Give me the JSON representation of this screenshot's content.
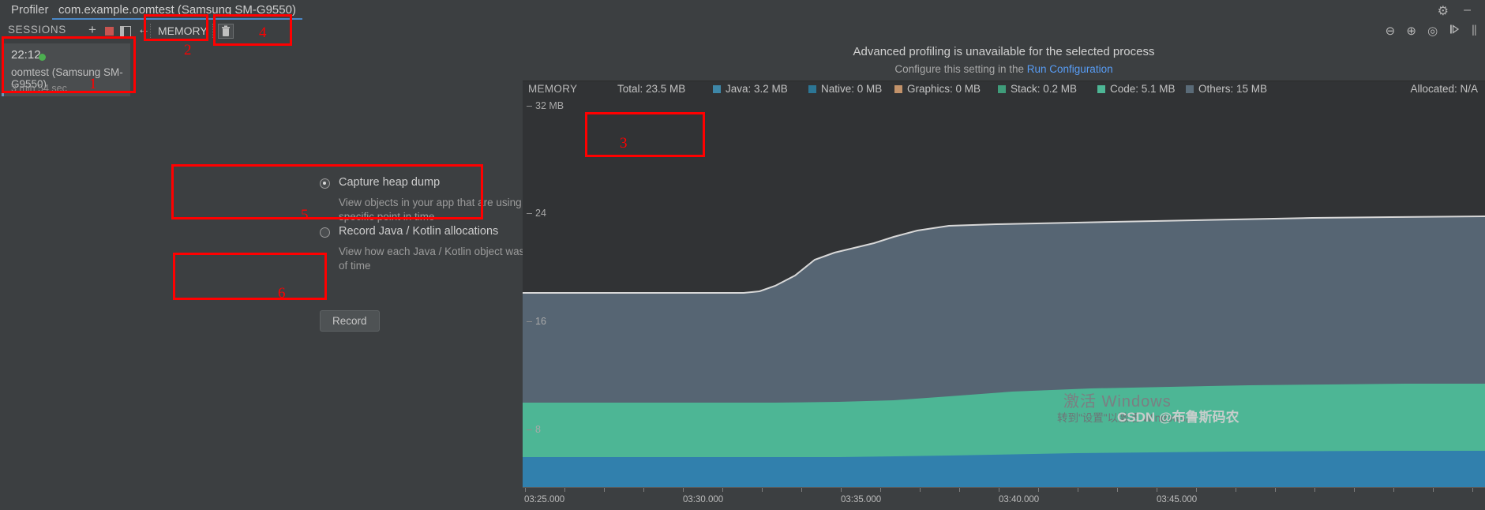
{
  "window": {
    "tab_profiler": "Profiler",
    "tab_process": "com.example.oomtest (Samsung SM-G9550)",
    "gear_icon": "gear-icon",
    "minimize_icon": "minimize-icon"
  },
  "toolbar": {
    "sessions_label": "SESSIONS",
    "add_icon": "+",
    "stop_icon": "stop-square-icon",
    "panel_icon": "split-panel-icon",
    "collapse_icon": "←",
    "memory_dropdown": "MEMORY",
    "caret": "▼",
    "trash_icon": "trash-icon",
    "zoom_out_icon": "⊖",
    "zoom_in_icon": "⊕",
    "reset_zoom_icon": "◎",
    "jump_to_live_icon": "jump-live-icon",
    "pause_icon": "‖"
  },
  "sessions": {
    "items": [
      {
        "time": "22:12",
        "status_dot": "green",
        "name": "oomtest (Samsung SM-G9550)",
        "duration": "3 min 54 sec"
      }
    ]
  },
  "capture_panel": {
    "options": [
      {
        "label": "Capture heap dump",
        "description": "View objects in your app that are using memory at a specific point in time",
        "selected": true
      },
      {
        "label": "Record Java / Kotlin allocations",
        "description": "View how each Java / Kotlin object was allocated over a period of time",
        "selected": false
      }
    ],
    "record_button": "Record"
  },
  "graph": {
    "banner_title": "Advanced profiling is unavailable for the selected process",
    "banner_sub_prefix": "Configure this setting in the ",
    "banner_link": "Run Configuration",
    "legend_title": "MEMORY",
    "total": "Total: 23.5 MB",
    "allocated": "Allocated: N/A",
    "series": [
      {
        "name": "Java",
        "value": "Java: 3.2 MB",
        "color": "#3e87a8"
      },
      {
        "name": "Native",
        "value": "Native: 0 MB",
        "color": "#2c7695"
      },
      {
        "name": "Graphics",
        "value": "Graphics: 0 MB",
        "color": "#c2926a"
      },
      {
        "name": "Stack",
        "value": "Stack: 0.2 MB",
        "color": "#3f9c7a"
      },
      {
        "name": "Code",
        "value": "Code: 5.1 MB",
        "color": "#4db695"
      },
      {
        "name": "Others",
        "value": "Others: 15 MB",
        "color": "#5a6b78"
      }
    ]
  },
  "chart_data": {
    "type": "area",
    "title": "MEMORY",
    "ylabel": "MB",
    "xlabel": "",
    "ylim": [
      0,
      34
    ],
    "yticks": [
      "32 MB",
      "24",
      "16",
      "8"
    ],
    "ytick_values": [
      32,
      24,
      16,
      8
    ],
    "xticks": [
      "03:25.000",
      "03:30.000",
      "03:35.000",
      "03:40.000",
      "03:45.000"
    ],
    "grid": false,
    "legend_position": "top",
    "series": [
      {
        "name": "Others",
        "color": "#5a6b78",
        "values": [
          17.0,
          17.0,
          17.0,
          17.0,
          17.0,
          17.0,
          17.0,
          17.0,
          17.0,
          17.0,
          17.3,
          19.0,
          20.5,
          21.2,
          21.5,
          22.0,
          23.0,
          23.4,
          23.5,
          23.5,
          23.5,
          23.6,
          23.6,
          23.7,
          23.8
        ]
      },
      {
        "name": "Code",
        "color": "#4db695",
        "values": [
          7.4,
          7.4,
          7.4,
          7.4,
          7.4,
          7.4,
          7.4,
          7.4,
          7.4,
          7.4,
          7.4,
          7.4,
          7.4,
          7.4,
          7.4,
          7.5,
          7.8,
          8.1,
          8.3,
          8.4,
          8.4,
          8.4,
          8.4,
          8.4,
          8.4
        ]
      },
      {
        "name": "Java",
        "color": "#3e87a8",
        "values": [
          2.3,
          2.3,
          2.3,
          2.3,
          2.3,
          2.3,
          2.3,
          2.3,
          2.3,
          2.3,
          2.3,
          2.3,
          2.3,
          2.3,
          2.3,
          2.3,
          2.4,
          2.6,
          2.7,
          2.7,
          2.7,
          2.7,
          2.7,
          2.7,
          2.7
        ]
      }
    ]
  },
  "watermark": {
    "windows_line1": "激活 Windows",
    "windows_line2": "转到\"设置\"以激活 Windows。",
    "csdn": "CSDN @布鲁斯码农"
  },
  "annotations": [
    {
      "id": "1",
      "label": "1"
    },
    {
      "id": "2",
      "label": "2"
    },
    {
      "id": "3",
      "label": "3"
    },
    {
      "id": "4",
      "label": "4"
    },
    {
      "id": "5",
      "label": "5"
    },
    {
      "id": "6",
      "label": "6"
    }
  ]
}
